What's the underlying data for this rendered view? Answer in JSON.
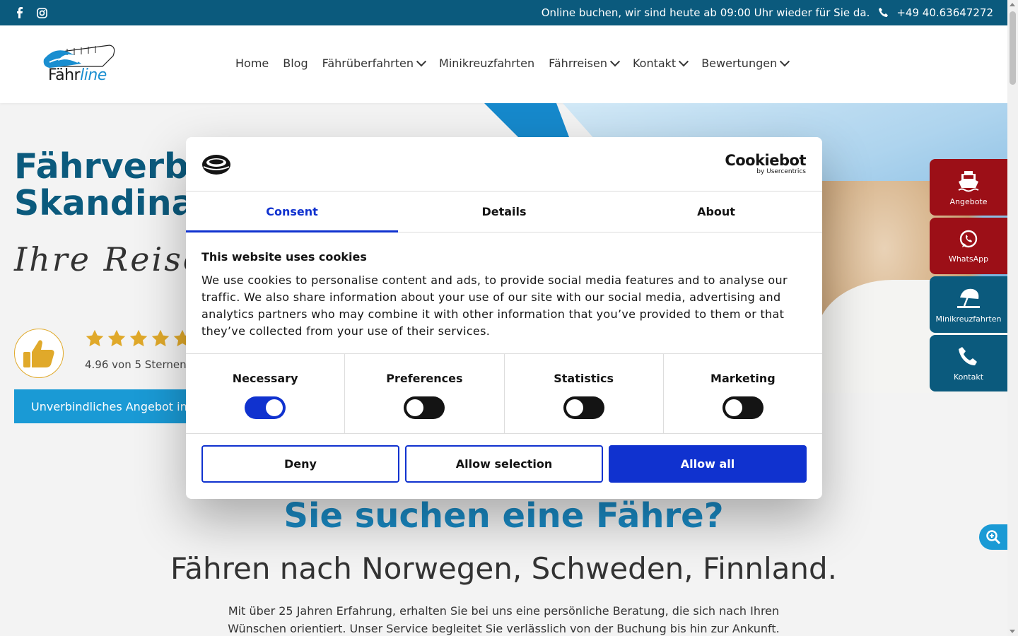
{
  "topbar": {
    "info_text": "Online buchen, wir sind heute ab 09:00 Uhr wieder für Sie da.",
    "phone": "+49 40.63647272",
    "icons": [
      "facebook-icon",
      "instagram-icon",
      "phone-icon"
    ]
  },
  "header": {
    "logo_text_main": "Fähr",
    "logo_text_accent": "line",
    "nav": [
      {
        "label": "Home",
        "dropdown": false
      },
      {
        "label": "Blog",
        "dropdown": false
      },
      {
        "label": "Fährüberfahrten",
        "dropdown": true
      },
      {
        "label": "Minikreuzfahrten",
        "dropdown": false
      },
      {
        "label": "Fährreisen",
        "dropdown": true
      },
      {
        "label": "Kontakt",
        "dropdown": true
      },
      {
        "label": "Bewertungen",
        "dropdown": true
      }
    ]
  },
  "hero": {
    "title_line1": "Fährverbin",
    "title_line2": "Skandinav",
    "script": "Ihre Reise ",
    "rating_text": "4.96 von 5 Sternen",
    "stars": 5,
    "cta_label": "Unverbindliches Angebot in"
  },
  "section": {
    "title": "Sie suchen eine Fähre?",
    "subtitle": "Fähren nach Norwegen, Schweden, Finnland.",
    "body": "Mit über 25 Jahren Erfahrung, erhalten Sie bei uns eine persönliche Beratung, die sich nach Ihren Wünschen orientiert. Unser Service begleitet Sie verlässlich von der Buchung bis hin zur Ankunft. Auch bei"
  },
  "side_buttons": [
    {
      "label": "Angebote",
      "icon": "ferry-icon",
      "color": "#9c0f17"
    },
    {
      "label": "WhatsApp",
      "icon": "whatsapp-icon",
      "color": "#9c0f17"
    },
    {
      "label": "Minikreuzfahrten",
      "icon": "beach-umbrella-icon",
      "color": "#0b5a7d"
    },
    {
      "label": "Kontakt",
      "icon": "phone-icon",
      "color": "#0b5a7d"
    }
  ],
  "cookie_dialog": {
    "brand_name": "Cookiebot",
    "brand_by": "by Usercentrics",
    "tabs": [
      {
        "label": "Consent",
        "active": true
      },
      {
        "label": "Details",
        "active": false
      },
      {
        "label": "About",
        "active": false
      }
    ],
    "heading": "This website uses cookies",
    "text": "We use cookies to personalise content and ads, to provide social media features and to analyse our traffic. We also share information about your use of our site with our social media, advertising and analytics partners who may combine it with other information that you’ve provided to them or that they’ve collected from your use of their services.",
    "toggles": [
      {
        "label": "Necessary",
        "on": true
      },
      {
        "label": "Preferences",
        "on": false
      },
      {
        "label": "Statistics",
        "on": false
      },
      {
        "label": "Marketing",
        "on": false
      }
    ],
    "buttons": {
      "deny": "Deny",
      "allow_selection": "Allow selection",
      "allow_all": "Allow all"
    }
  },
  "colors": {
    "brand_dark": "#0b5a7d",
    "brand_light": "#1a9ad5",
    "cookie_blue": "#1032cf",
    "side_red": "#9c0f17",
    "star_gold": "#e0a92a"
  }
}
